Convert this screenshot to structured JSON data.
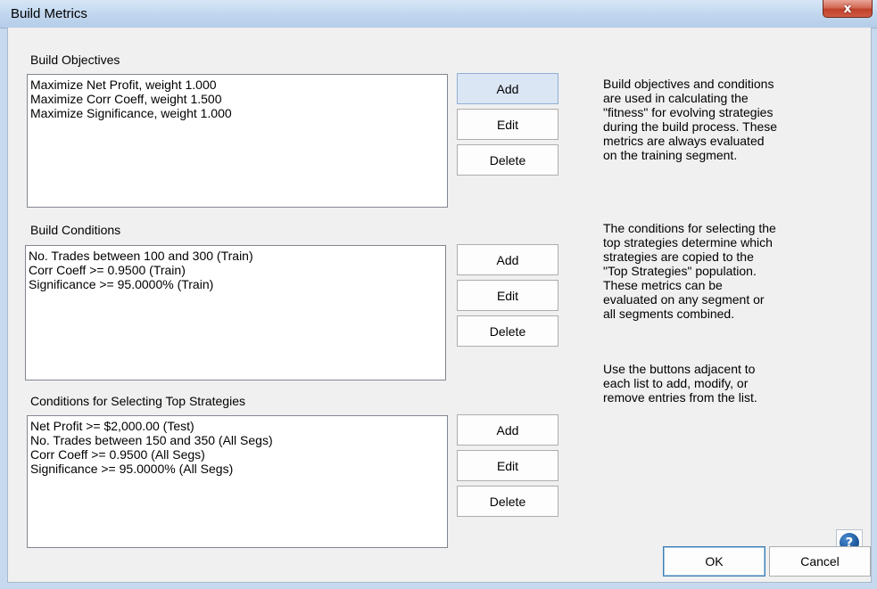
{
  "window": {
    "title": "Build Metrics",
    "close_glyph": "x"
  },
  "objectives": {
    "label": "Build Objectives",
    "items": [
      "Maximize Net Profit, weight 1.000",
      "Maximize Corr Coeff, weight 1.500",
      "Maximize Significance, weight 1.000"
    ],
    "add_label": "Add",
    "edit_label": "Edit",
    "delete_label": "Delete"
  },
  "conditions": {
    "label": "Build Conditions",
    "items": [
      "No. Trades between  100 and 300 (Train)",
      "Corr Coeff >=  0.9500 (Train)",
      "Significance >=  95.0000% (Train)"
    ],
    "add_label": "Add",
    "edit_label": "Edit",
    "delete_label": "Delete"
  },
  "top_strategies": {
    "label": "Conditions for Selecting Top Strategies",
    "items": [
      "Net Profit >=  $2,000.00 (Test)",
      "No. Trades between  150 and 350 (All Segs)",
      "Corr Coeff >=  0.9500 (All Segs)",
      "Significance >=  95.0000% (All Segs)"
    ],
    "add_label": "Add",
    "edit_label": "Edit",
    "delete_label": "Delete"
  },
  "help": {
    "para1": "Build objectives and conditions\nare used in calculating the\n\"fitness\" for evolving strategies\nduring the build process. These\nmetrics are always evaluated\non the training segment.",
    "para2": "The conditions for selecting the\ntop strategies determine which\nstrategies are copied to the\n\"Top Strategies\" population.\nThese metrics can be\nevaluated on any segment or\nall segments combined.",
    "para3": "Use the buttons adjacent to\neach list to add, modify, or\nremove entries from the list.",
    "icon_glyph": "?"
  },
  "footer": {
    "ok_label": "OK",
    "cancel_label": "Cancel"
  },
  "colors": {
    "titlebar": "#c2d7ef",
    "close": "#c0412a",
    "help_icon": "#1e5a9e"
  },
  "icons": {
    "close": "close-icon",
    "help": "help-icon"
  }
}
